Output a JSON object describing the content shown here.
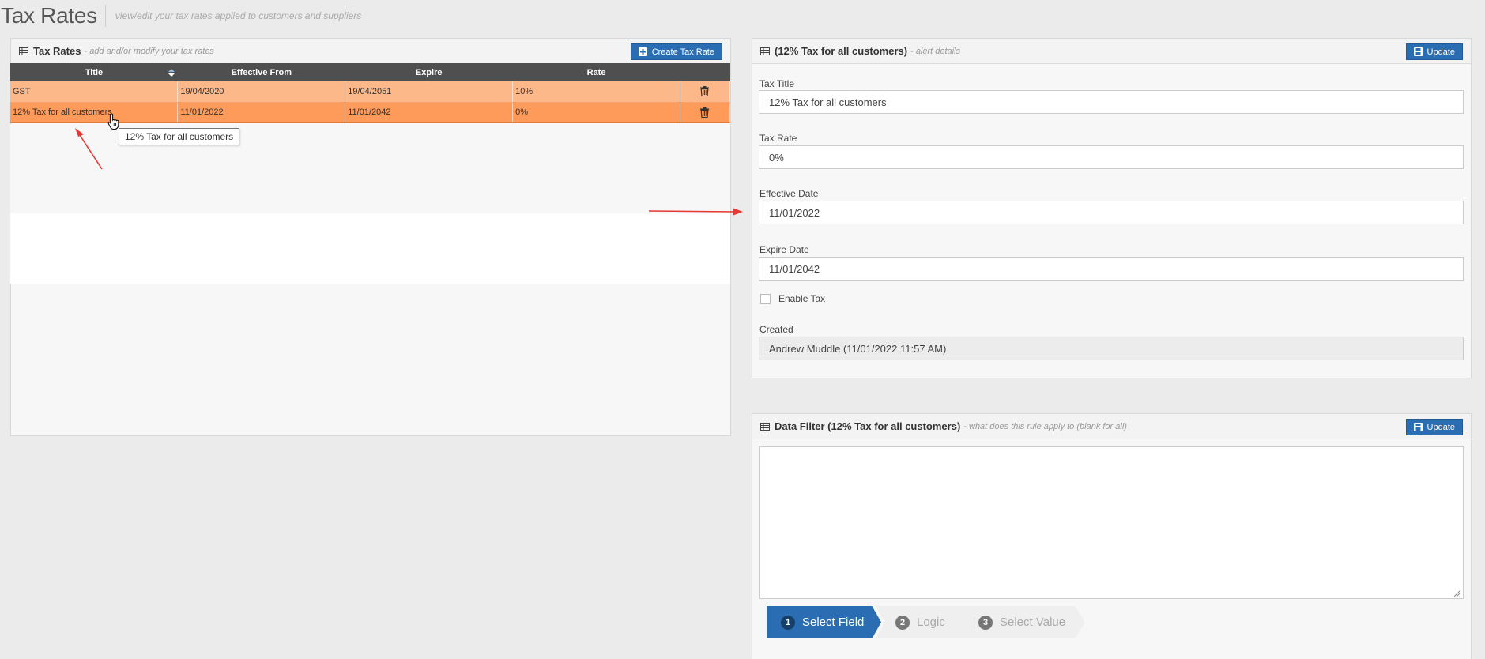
{
  "page": {
    "title": "Tax Rates",
    "subtitle": "view/edit your tax rates applied to customers and suppliers"
  },
  "left_panel": {
    "title": "Tax Rates",
    "subtitle": "- add and/or modify your tax rates",
    "create_button": "Create Tax Rate",
    "columns": [
      "Title",
      "Effective From",
      "Expire",
      "Rate"
    ],
    "rows": [
      {
        "title": "GST",
        "effective_from": "19/04/2020",
        "expire": "19/04/2051",
        "rate": "10%"
      },
      {
        "title": "12% Tax for all customers",
        "effective_from": "11/01/2022",
        "expire": "11/01/2042",
        "rate": "0%"
      }
    ],
    "tooltip": "12% Tax for all customers"
  },
  "detail_panel": {
    "title": "(12% Tax for all customers)",
    "subtitle": "- alert details",
    "update_button": "Update",
    "fields": {
      "tax_title_label": "Tax Title",
      "tax_title_value": "12% Tax for all customers",
      "tax_rate_label": "Tax Rate",
      "tax_rate_value": "0%",
      "effective_date_label": "Effective Date",
      "effective_date_value": "11/01/2022",
      "expire_date_label": "Expire Date",
      "expire_date_value": "11/01/2042",
      "enable_tax_label": "Enable Tax",
      "enable_tax_checked": false,
      "created_label": "Created",
      "created_value": "Andrew Muddle (11/01/2022 11:57 AM)"
    }
  },
  "filter_panel": {
    "title": "Data Filter (12% Tax for all customers)",
    "subtitle": "- what does this rule apply to (blank for all)",
    "update_button": "Update",
    "textarea_value": "",
    "steps": [
      {
        "num": "1",
        "label": "Select Field",
        "active": true
      },
      {
        "num": "2",
        "label": "Logic",
        "active": false
      },
      {
        "num": "3",
        "label": "Select Value",
        "active": false
      }
    ]
  },
  "colors": {
    "accent_blue": "#2a6db2",
    "row_light_orange": "#fdb88a",
    "row_selected_orange": "#fe9a5a",
    "header_dark": "#4f4f4f",
    "annotation_red": "#e53935"
  },
  "icons": [
    "grid-icon",
    "plus-square-icon",
    "save-icon",
    "sort-icon",
    "trash-icon",
    "hand-cursor-icon"
  ]
}
